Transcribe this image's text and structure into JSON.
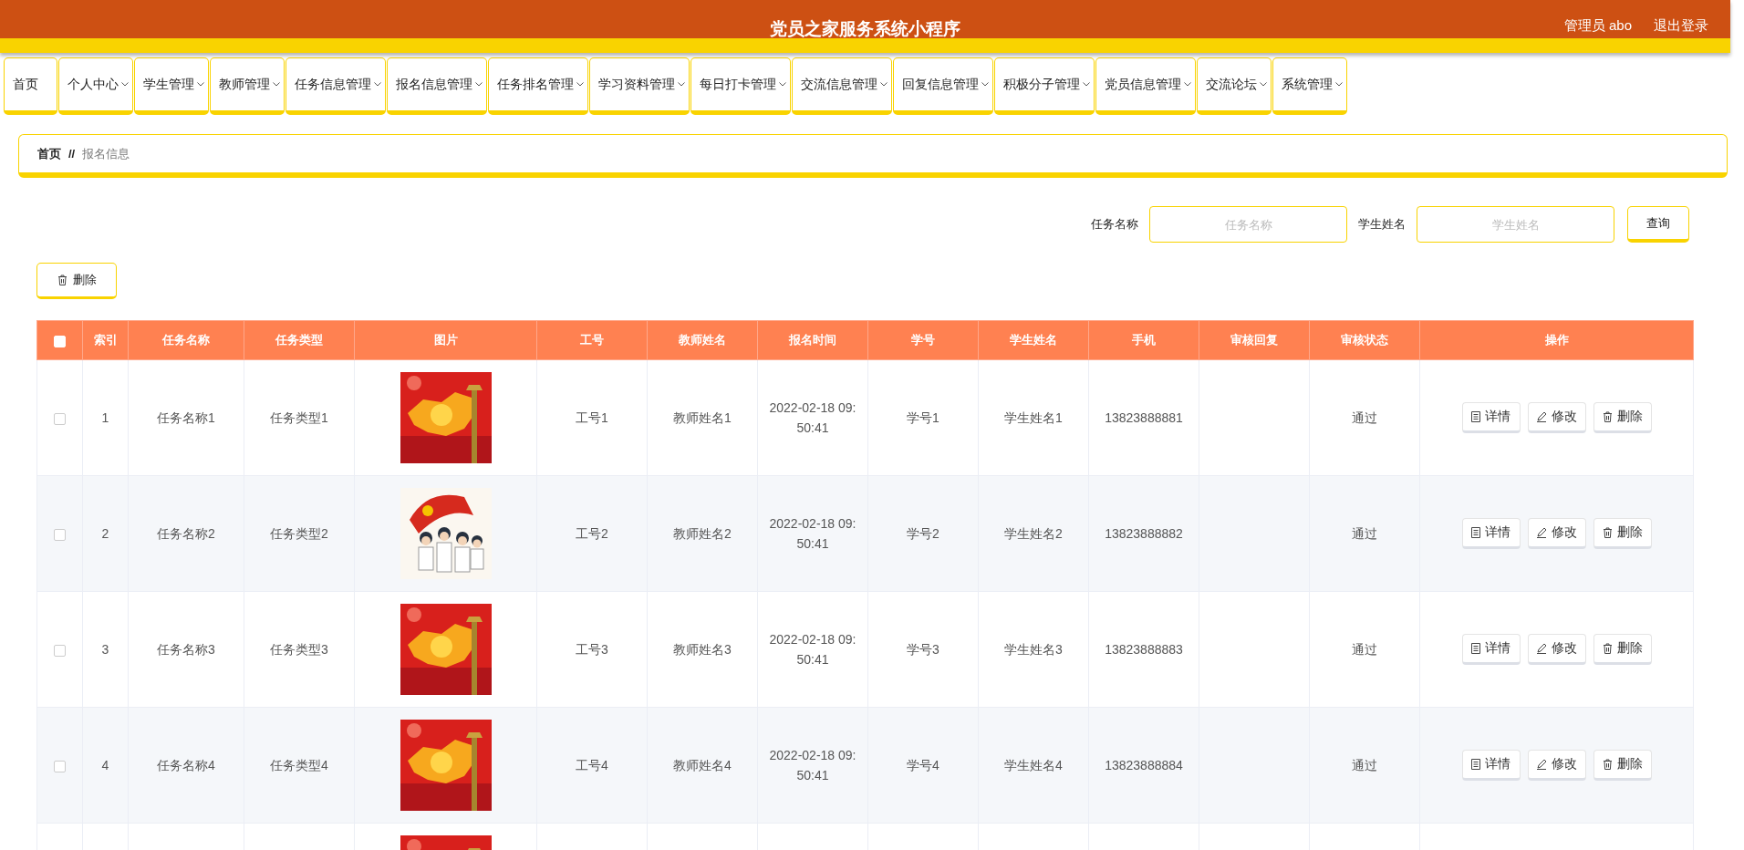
{
  "header": {
    "title": "党员之家服务系统小程序",
    "user": "管理员 abo",
    "logout": "退出登录"
  },
  "nav": [
    {
      "label": "首页",
      "dropdown": false
    },
    {
      "label": "个人中心",
      "dropdown": true
    },
    {
      "label": "学生管理",
      "dropdown": true
    },
    {
      "label": "教师管理",
      "dropdown": true
    },
    {
      "label": "任务信息管理",
      "dropdown": true
    },
    {
      "label": "报名信息管理",
      "dropdown": true
    },
    {
      "label": "任务排名管理",
      "dropdown": true
    },
    {
      "label": "学习资料管理",
      "dropdown": true
    },
    {
      "label": "每日打卡管理",
      "dropdown": true
    },
    {
      "label": "交流信息管理",
      "dropdown": true
    },
    {
      "label": "回复信息管理",
      "dropdown": true
    },
    {
      "label": "积极分子管理",
      "dropdown": true
    },
    {
      "label": "党员信息管理",
      "dropdown": true
    },
    {
      "label": "交流论坛",
      "dropdown": true
    },
    {
      "label": "系统管理",
      "dropdown": true
    }
  ],
  "breadcrumb": {
    "home": "首页",
    "separator": "//",
    "current": "报名信息"
  },
  "search": {
    "fields": [
      {
        "label": "任务名称",
        "placeholder": "任务名称"
      },
      {
        "label": "学生姓名",
        "placeholder": "学生姓名"
      }
    ],
    "button": "查询"
  },
  "toolbar": {
    "delete": "删除"
  },
  "table": {
    "select_all": {
      "checked": false
    },
    "columns": [
      "索引",
      "任务名称",
      "任务类型",
      "图片",
      "工号",
      "教师姓名",
      "报名时间",
      "学号",
      "学生姓名",
      "手机",
      "审核回复",
      "审核状态",
      "操作"
    ],
    "rows": [
      {
        "checked": false,
        "index": "1",
        "task": "任务名称1",
        "type": "任务类型1",
        "image": {
          "kind": "picture"
        },
        "staff_no": "工号1",
        "teacher": "教师姓名1",
        "time": "2022-02-18 09:50:41",
        "student_no": "学号1",
        "student": "学生姓名1",
        "phone": "13823888881",
        "status": "通过",
        "actions": [
          "详情",
          "修改",
          "删除"
        ]
      },
      {
        "checked": false,
        "index": "2",
        "task": "任务名称2",
        "type": "任务类型2",
        "image": {
          "kind": "picture"
        },
        "staff_no": "工号2",
        "teacher": "教师姓名2",
        "time": "2022-02-18 09:50:41",
        "student_no": "学号2",
        "student": "学生姓名2",
        "phone": "13823888882",
        "status": "通过",
        "actions": [
          "详情",
          "修改",
          "删除"
        ]
      },
      {
        "checked": false,
        "index": "3",
        "task": "任务名称3",
        "type": "任务类型3",
        "image": {
          "kind": "picture"
        },
        "staff_no": "工号3",
        "teacher": "教师姓名3",
        "time": "2022-02-18 09:50:41",
        "student_no": "学号3",
        "student": "学生姓名3",
        "phone": "13823888883",
        "status": "通过",
        "actions": [
          "详情",
          "修改",
          "删除"
        ]
      },
      {
        "checked": false,
        "index": "4",
        "task": "任务名称4",
        "type": "任务类型4",
        "image": {
          "kind": "picture"
        },
        "staff_no": "工号4",
        "teacher": "教师姓名4",
        "time": "2022-02-18 09:50:41",
        "student_no": "学号4",
        "student": "学生姓名4",
        "phone": "13823888884",
        "status": "通过",
        "actions": [
          "详情",
          "修改",
          "删除"
        ]
      },
      {
        "image": {
          "kind": "picture"
        }
      }
    ]
  }
}
